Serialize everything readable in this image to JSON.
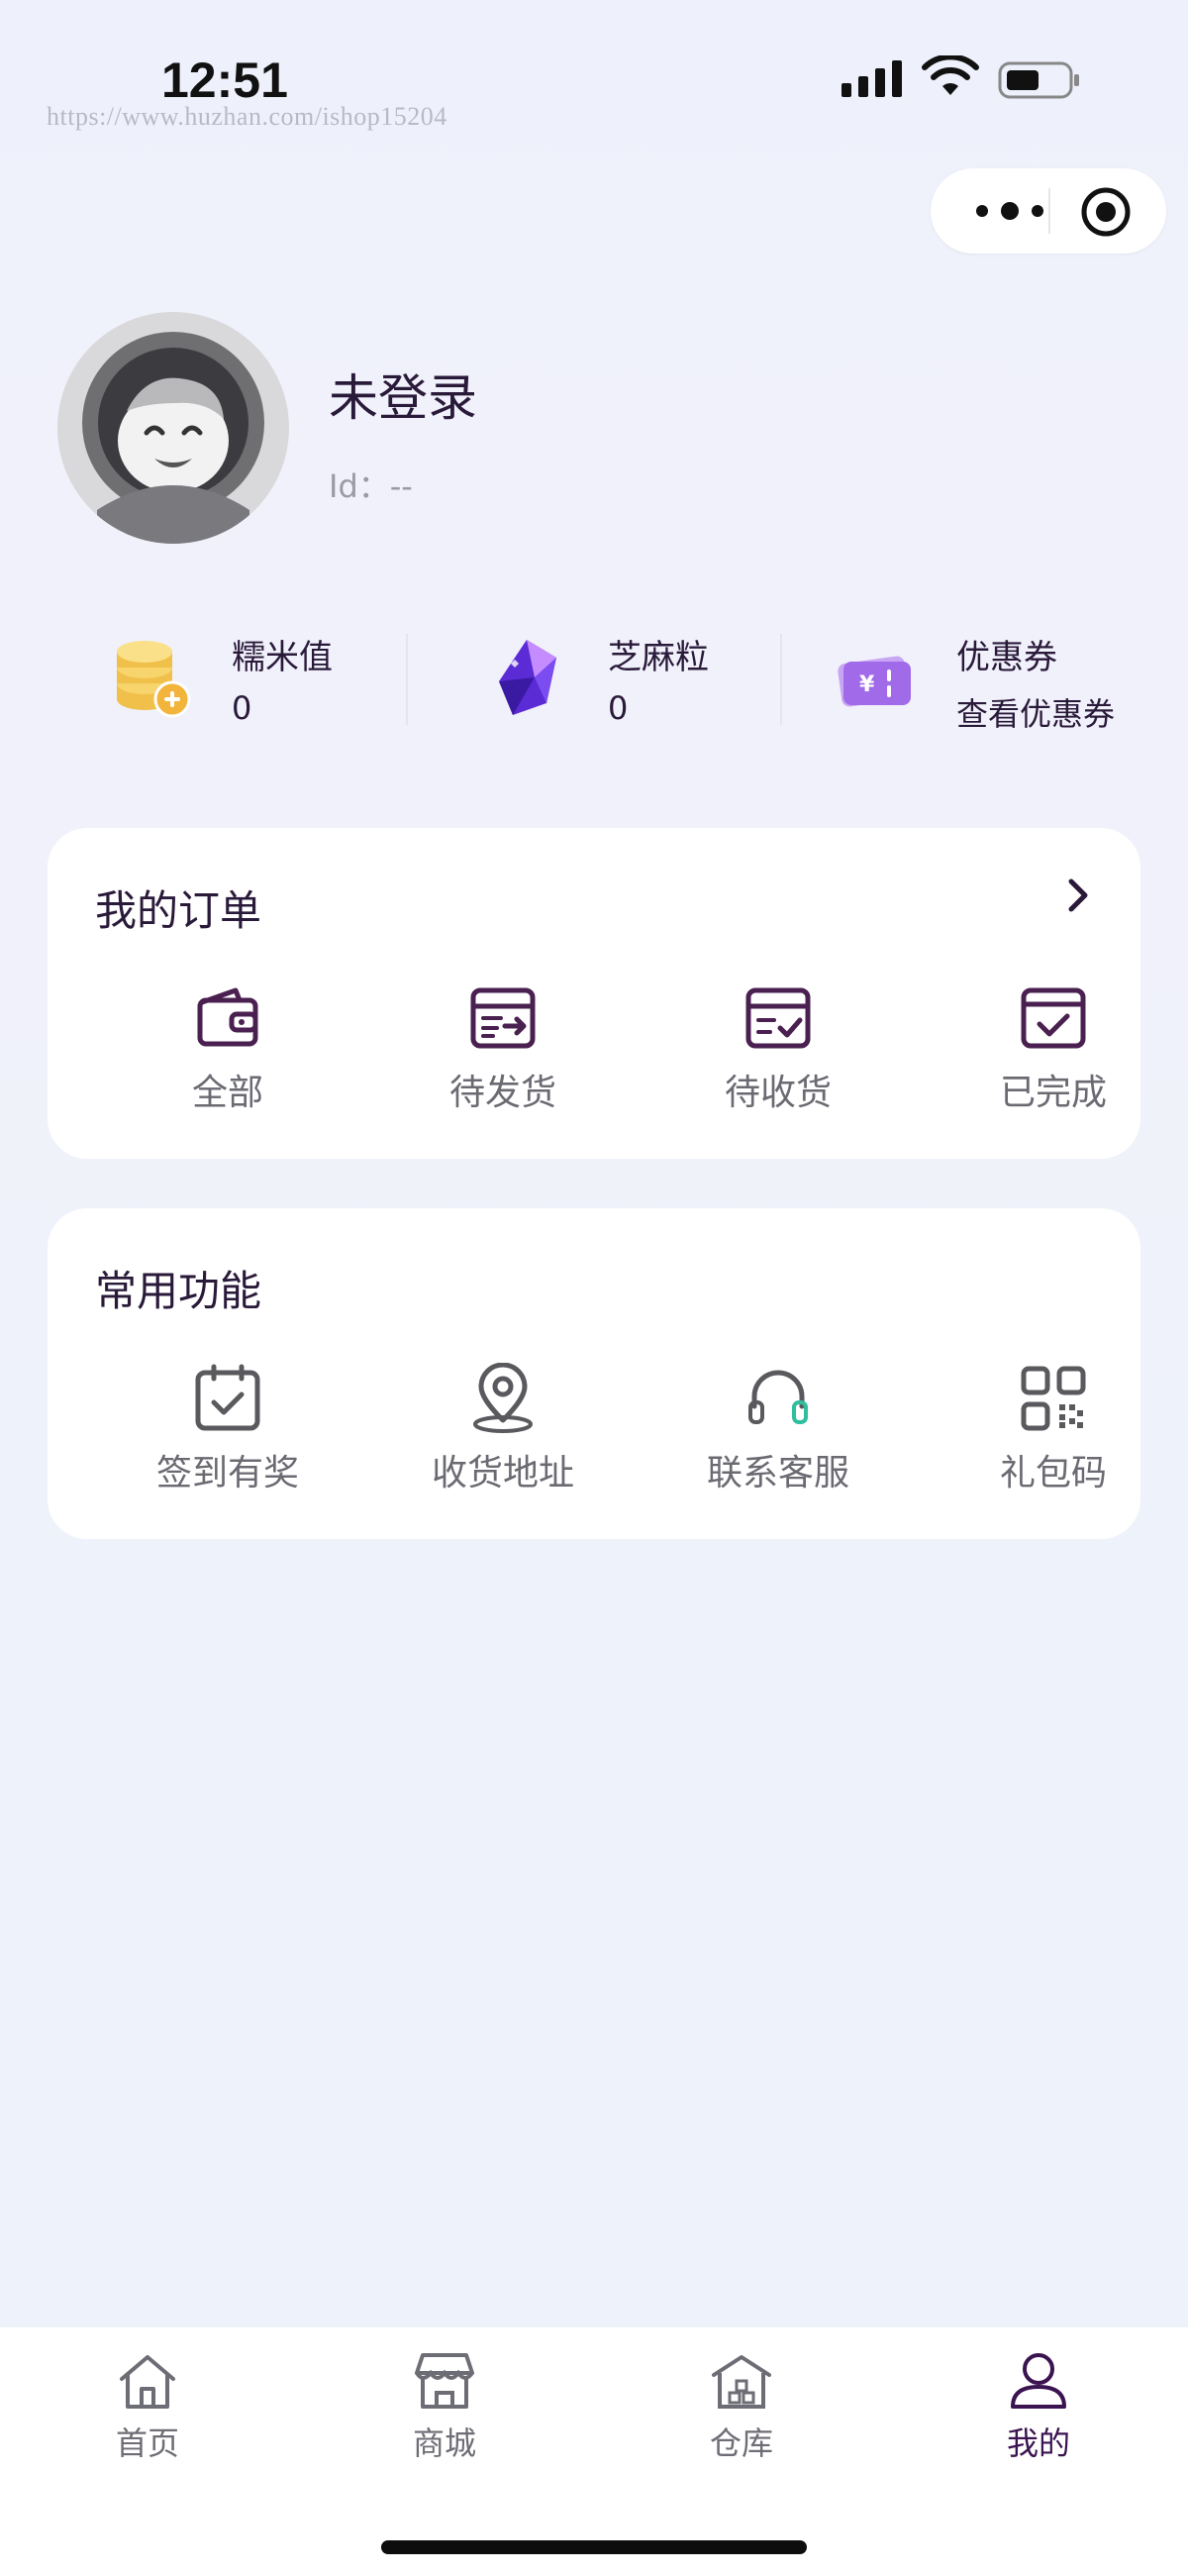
{
  "status_bar": {
    "time": "12:51",
    "watermark": "https://www.huzhan.com/ishop15204"
  },
  "profile": {
    "name": "未登录",
    "id_text": "Id：--"
  },
  "stats": [
    {
      "label": "糯米值",
      "value": "0",
      "icon": "coins-icon"
    },
    {
      "label": "芝麻粒",
      "value": "0",
      "icon": "crystal-icon"
    },
    {
      "label": "优惠券",
      "value": "查看优惠券",
      "icon": "ticket-icon"
    }
  ],
  "orders": {
    "title": "我的订单",
    "items": [
      {
        "label": "全部",
        "icon": "wallet-icon"
      },
      {
        "label": "待发货",
        "icon": "box-ship-icon"
      },
      {
        "label": "待收货",
        "icon": "box-receive-icon"
      },
      {
        "label": "已完成",
        "icon": "box-done-icon"
      }
    ]
  },
  "functions": {
    "title": "常用功能",
    "items": [
      {
        "label": "签到有奖",
        "icon": "calendar-check-icon"
      },
      {
        "label": "收货地址",
        "icon": "location-pin-icon"
      },
      {
        "label": "联系客服",
        "icon": "headset-icon"
      },
      {
        "label": "礼包码",
        "icon": "qr-code-icon"
      }
    ]
  },
  "tabbar": {
    "items": [
      {
        "label": "首页",
        "icon": "home-icon",
        "active": false
      },
      {
        "label": "商城",
        "icon": "store-icon",
        "active": false
      },
      {
        "label": "仓库",
        "icon": "warehouse-icon",
        "active": false
      },
      {
        "label": "我的",
        "icon": "user-icon",
        "active": true
      }
    ]
  },
  "colors": {
    "accent": "#3a1350",
    "icon_dark": "#4a2050",
    "text_muted": "#6a6a72"
  }
}
